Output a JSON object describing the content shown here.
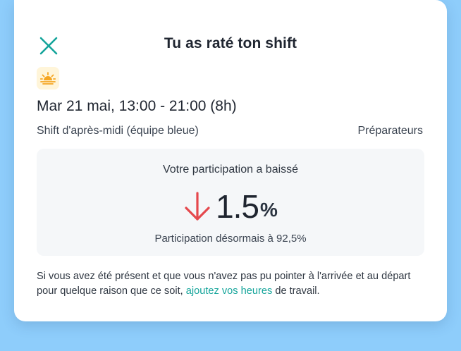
{
  "modal": {
    "title": "Tu as raté ton shift",
    "close_icon": "close-icon",
    "shift_icon": "sunset-icon",
    "date_time": "Mar 21 mai, 13:00 - 21:00 (8h)",
    "shift_name": "Shift d'après-midi (équipe bleue)",
    "role": "Préparateurs"
  },
  "participation": {
    "heading": "Votre participation a baissé",
    "trend_icon": "arrow-down-icon",
    "change_value": "1.5",
    "change_unit": "%",
    "new_rate_text": "Participation désormais à 92,5%"
  },
  "note": {
    "text_before": "Si vous avez été présent et que vous n'avez pas pu pointer à l'arrivée et au départ pour quelque raison que ce soit, ",
    "link_text": "ajoutez vos heures",
    "text_after": " de travail."
  },
  "colors": {
    "background": "#8ecdfb",
    "accent": "#14a49a",
    "decline": "#e5484d",
    "sun": "#f5a623",
    "panel": "#f5f7f9"
  }
}
